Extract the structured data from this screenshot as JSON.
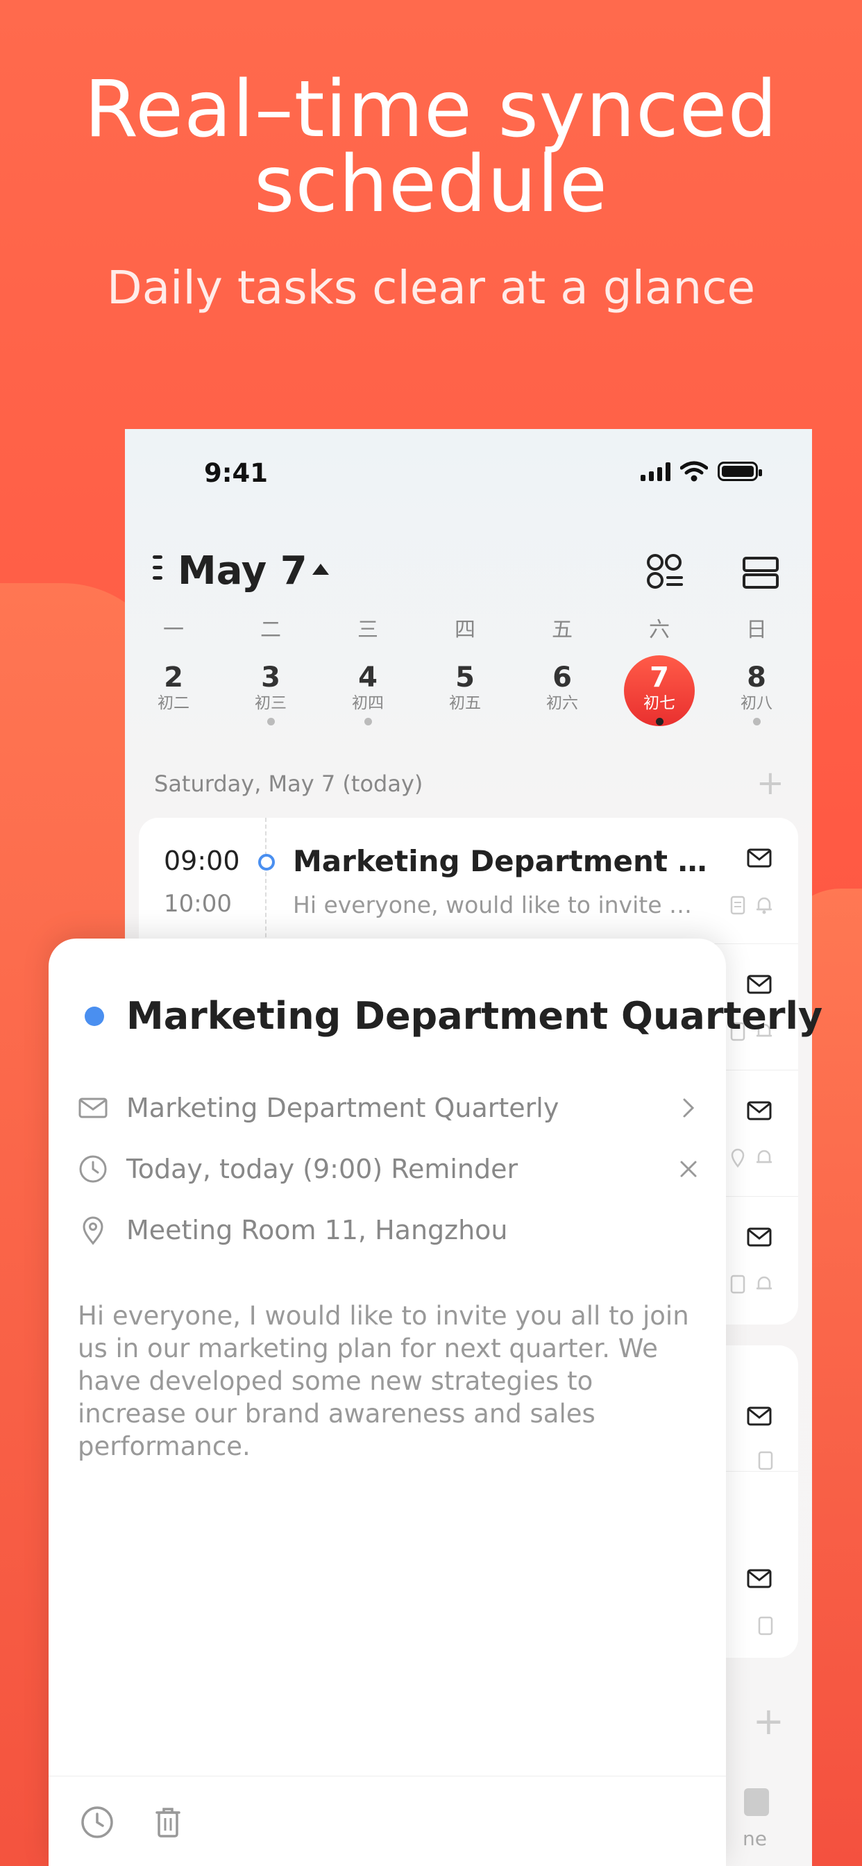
{
  "hero": {
    "title_line1": "Real–time synced",
    "title_line2": "schedule",
    "subtitle": "Daily tasks clear at a glance"
  },
  "status_bar": {
    "time": "9:41"
  },
  "calendar": {
    "month_label": "May 7",
    "weekdays": [
      "一",
      "二",
      "三",
      "四",
      "五",
      "六",
      "日"
    ],
    "days": [
      {
        "num": "2",
        "lunar": "初二",
        "has_event": false
      },
      {
        "num": "3",
        "lunar": "初三",
        "has_event": true
      },
      {
        "num": "4",
        "lunar": "初四",
        "has_event": true
      },
      {
        "num": "5",
        "lunar": "初五",
        "has_event": false
      },
      {
        "num": "6",
        "lunar": "初六",
        "has_event": false
      },
      {
        "num": "7",
        "lunar": "初七",
        "has_event": true,
        "today": true
      },
      {
        "num": "8",
        "lunar": "初八",
        "has_event": true
      }
    ],
    "date_line": "Saturday, May 7 (today)",
    "add_symbol": "+"
  },
  "events": [
    {
      "start": "09:00",
      "end": "10:00",
      "title": "Marketing Department Quart...",
      "desc": "Hi everyone, would like to invite yo..."
    }
  ],
  "detail": {
    "title": "Marketing Department Quarterly",
    "mail_row": "Marketing Department Quarterly",
    "reminder_row": "Today, today (9:00) Reminder",
    "location_row": "Meeting Room 11, Hangzhou",
    "body": "Hi everyone, I would like to invite you all to join us in our marketing plan for next quarter. We have developed some new strategies to increase our brand awareness and sales performance."
  },
  "tab_bar": {
    "partial_label": "ne"
  },
  "colors": {
    "accent": "#ff5a44",
    "event_dot": "#4a8ff0",
    "today": "#e9302f"
  },
  "icons": [
    "menu-icon",
    "grid-view-icon",
    "list-view-icon",
    "mail-icon",
    "note-icon",
    "bell-icon",
    "location-icon",
    "chevron-right-icon",
    "close-icon",
    "clock-icon",
    "trash-icon",
    "plus-icon"
  ]
}
